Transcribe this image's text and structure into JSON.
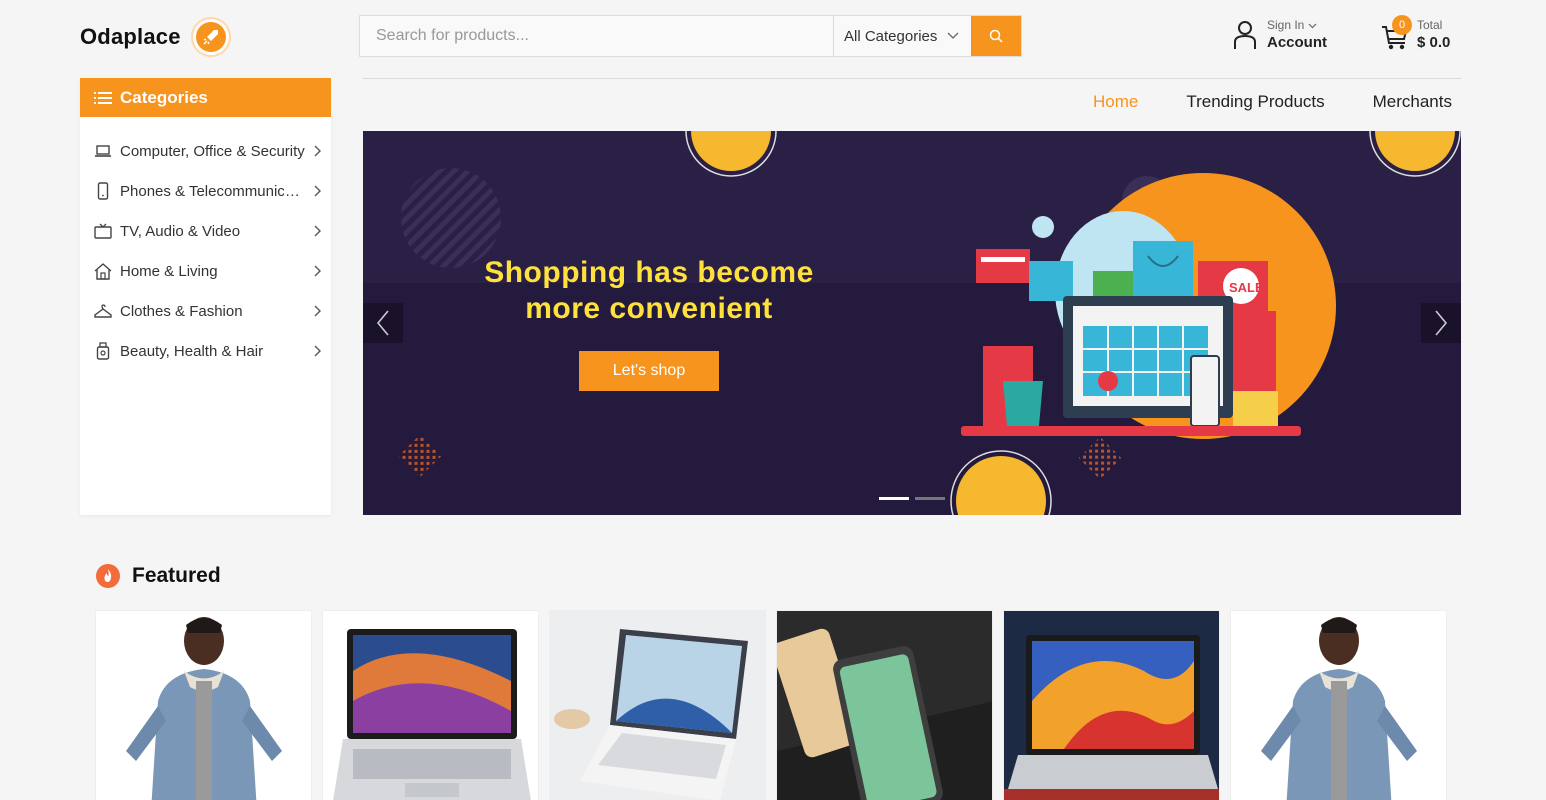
{
  "brand": {
    "name": "Odaplace",
    "accent": "#f7941d"
  },
  "search": {
    "placeholder": "Search for products...",
    "category": "All Categories"
  },
  "account": {
    "sign_in": "Sign In",
    "label": "Account"
  },
  "cart": {
    "count": "0",
    "total_label": "Total",
    "total": "$ 0.0"
  },
  "sidebar": {
    "title": "Categories",
    "items": [
      {
        "label": "Computer, Office & Security",
        "icon": "laptop-icon"
      },
      {
        "label": "Phones & Telecommunications",
        "icon": "phone-icon"
      },
      {
        "label": "TV, Audio & Video",
        "icon": "tv-icon"
      },
      {
        "label": "Home & Living",
        "icon": "home-icon"
      },
      {
        "label": "Clothes & Fashion",
        "icon": "hanger-icon"
      },
      {
        "label": "Beauty, Health & Hair",
        "icon": "perfume-icon"
      }
    ]
  },
  "nav": {
    "items": [
      {
        "label": "Home",
        "active": true
      },
      {
        "label": "Trending Products"
      },
      {
        "label": "Merchants"
      }
    ]
  },
  "banner": {
    "title_line1": "Shopping has become",
    "title_line2": "more convenient",
    "button": "Let's shop",
    "slide_count": 2,
    "active_slide": 1,
    "illustration_text": {
      "sale_tag": "SALE"
    }
  },
  "featured": {
    "title": "Featured",
    "products": [
      {
        "image": "denim-jacket-model"
      },
      {
        "image": "laptop-abstract-wave"
      },
      {
        "image": "laptop-white-desk"
      },
      {
        "image": "smartphones-pair"
      },
      {
        "image": "laptop-colorful-screen"
      },
      {
        "image": "denim-jacket-model"
      }
    ]
  }
}
